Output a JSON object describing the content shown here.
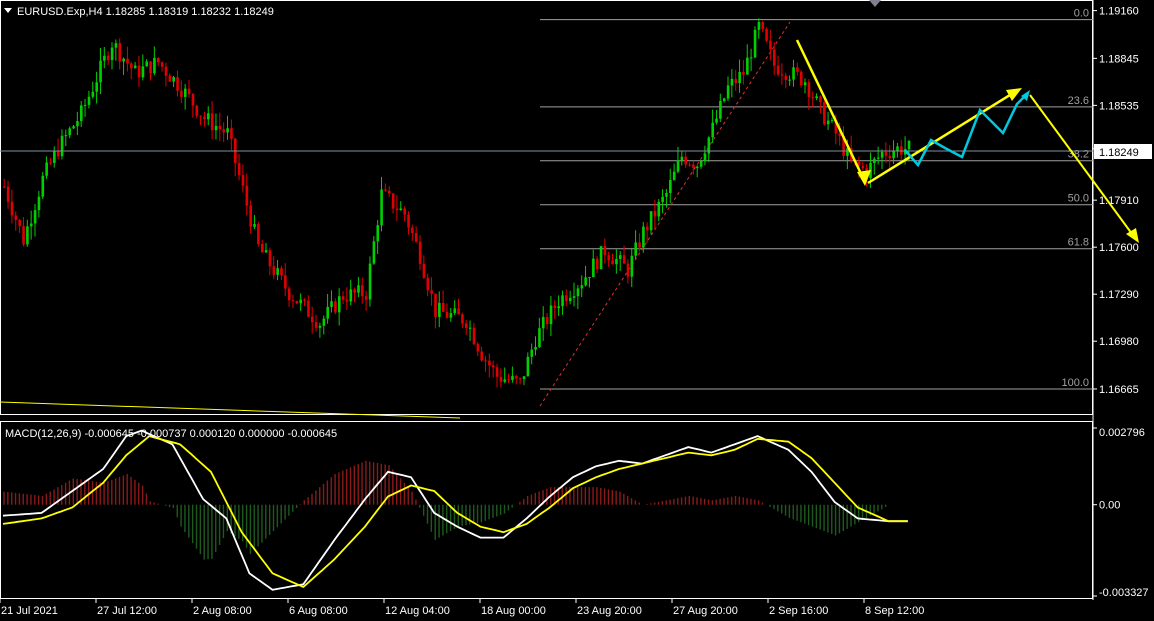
{
  "symbol_header": "EURUSD.Exp,H4  1.18285 1.18319 1.18232 1.18249",
  "macd_header": "MACD(12,26,9) -0.000645 -0.000737 0.000120 0.000000 -0.000645",
  "current_price": "1.18249",
  "colors": {
    "background": "#000000",
    "bull_candle": "#00d000",
    "bear_candle": "#e00000",
    "fib_line": "#a0a0a0",
    "macd_main": "#ffffff",
    "macd_signal": "#ffff00",
    "hist_pos": "#8b1a1a",
    "hist_neg": "#1e5a1e",
    "arrow_yellow": "#ffff00",
    "arrow_cyan": "#00c8e0"
  },
  "chart_data": [
    {
      "type": "candlestick",
      "symbol": "EURUSD.Exp",
      "timeframe": "H4",
      "ylim": [
        1.165,
        1.1921
      ],
      "y_ticks": [
        "1.19160",
        "1.18845",
        "1.18535",
        "1.18249",
        "1.17910",
        "1.17600",
        "1.17290",
        "1.16980",
        "1.16665"
      ],
      "x_ticks": [
        "21 Jul 2021",
        "27 Jul 12:00",
        "2 Aug 08:00",
        "6 Aug 08:00",
        "12 Aug 04:00",
        "18 Aug 00:00",
        "23 Aug 20:00",
        "27 Aug 20:00",
        "2 Sep 16:00",
        "8 Sep 12:00"
      ],
      "anchors": [
        [
          0,
          1.18
        ],
        [
          5,
          1.1765
        ],
        [
          10,
          1.1805
        ],
        [
          14,
          1.1825
        ],
        [
          20,
          1.1848
        ],
        [
          28,
          1.1895
        ],
        [
          34,
          1.1875
        ],
        [
          40,
          1.1882
        ],
        [
          46,
          1.1865
        ],
        [
          52,
          1.1845
        ],
        [
          58,
          1.1835
        ],
        [
          66,
          1.176
        ],
        [
          74,
          1.173
        ],
        [
          82,
          1.171
        ],
        [
          88,
          1.1728
        ],
        [
          94,
          1.173
        ],
        [
          98,
          1.1795
        ],
        [
          104,
          1.1782
        ],
        [
          108,
          1.1755
        ],
        [
          112,
          1.1718
        ],
        [
          120,
          1.1712
        ],
        [
          124,
          1.169
        ],
        [
          128,
          1.1675
        ],
        [
          134,
          1.167
        ],
        [
          138,
          1.17
        ],
        [
          144,
          1.1725
        ],
        [
          150,
          1.1738
        ],
        [
          156,
          1.1758
        ],
        [
          162,
          1.1745
        ],
        [
          166,
          1.177
        ],
        [
          172,
          1.1795
        ],
        [
          176,
          1.182
        ],
        [
          180,
          1.1815
        ],
        [
          184,
          1.1838
        ],
        [
          188,
          1.1865
        ],
        [
          192,
          1.1875
        ],
        [
          196,
          1.1905
        ],
        [
          200,
          1.188
        ],
        [
          204,
          1.1875
        ],
        [
          208,
          1.187
        ],
        [
          212,
          1.185
        ],
        [
          216,
          1.1835
        ],
        [
          220,
          1.1815
        ],
        [
          224,
          1.181
        ],
        [
          228,
          1.1822
        ],
        [
          232,
          1.1825
        ],
        [
          235,
          1.1825
        ]
      ],
      "fibonacci": {
        "levels": [
          {
            "label": "0.0",
            "price": 1.191
          },
          {
            "label": "23.6",
            "price": 1.18525
          },
          {
            "label": "38.2",
            "price": 1.1817
          },
          {
            "label": "50.0",
            "price": 1.1788
          },
          {
            "label": "61.8",
            "price": 1.1759
          },
          {
            "label": "100.0",
            "price": 1.16665
          }
        ]
      }
    },
    {
      "type": "line",
      "name": "MACD(12,26,9)",
      "ylim": [
        -0.003327,
        0.002796
      ],
      "y_ticks": [
        "0.002796",
        "0.00",
        "-0.003327"
      ],
      "series": [
        {
          "name": "main",
          "anchors": [
            [
              0,
              -0.0004
            ],
            [
              10,
              -0.0003
            ],
            [
              18,
              0.0005
            ],
            [
              26,
              0.0013
            ],
            [
              32,
              0.0025
            ],
            [
              36,
              0.0027
            ],
            [
              44,
              0.0022
            ],
            [
              52,
              0.0002
            ],
            [
              58,
              -0.0005
            ],
            [
              64,
              -0.0025
            ],
            [
              70,
              -0.0031
            ],
            [
              78,
              -0.0029
            ],
            [
              86,
              -0.0013
            ],
            [
              94,
              0.0002
            ],
            [
              100,
              0.0012
            ],
            [
              106,
              0.001
            ],
            [
              112,
              -0.0003
            ],
            [
              118,
              -0.0008
            ],
            [
              124,
              -0.0012
            ],
            [
              130,
              -0.0012
            ],
            [
              136,
              -0.0005
            ],
            [
              142,
              0.0003
            ],
            [
              148,
              0.001
            ],
            [
              154,
              0.0014
            ],
            [
              160,
              0.0016
            ],
            [
              166,
              0.0015
            ],
            [
              172,
              0.0018
            ],
            [
              178,
              0.0021
            ],
            [
              184,
              0.0019
            ],
            [
              190,
              0.0022
            ],
            [
              196,
              0.0025
            ],
            [
              204,
              0.002
            ],
            [
              210,
              0.0012
            ],
            [
              216,
              0.0001
            ],
            [
              222,
              -0.0005
            ],
            [
              230,
              -0.0006
            ],
            [
              235,
              -0.0006
            ]
          ]
        },
        {
          "name": "signal",
          "anchors": [
            [
              0,
              -0.0007
            ],
            [
              10,
              -0.0005
            ],
            [
              18,
              -0.0001
            ],
            [
              26,
              0.0008
            ],
            [
              32,
              0.0018
            ],
            [
              38,
              0.0025
            ],
            [
              46,
              0.0022
            ],
            [
              54,
              0.0012
            ],
            [
              62,
              -0.001
            ],
            [
              70,
              -0.0025
            ],
            [
              78,
              -0.003
            ],
            [
              86,
              -0.002
            ],
            [
              94,
              -0.0008
            ],
            [
              100,
              0.0003
            ],
            [
              106,
              0.0007
            ],
            [
              112,
              0.0005
            ],
            [
              118,
              -0.0003
            ],
            [
              124,
              -0.0008
            ],
            [
              130,
              -0.001
            ],
            [
              136,
              -0.0007
            ],
            [
              142,
              -0.0001
            ],
            [
              148,
              0.0006
            ],
            [
              154,
              0.001
            ],
            [
              160,
              0.0013
            ],
            [
              166,
              0.0015
            ],
            [
              172,
              0.0017
            ],
            [
              178,
              0.0019
            ],
            [
              184,
              0.0018
            ],
            [
              190,
              0.002
            ],
            [
              196,
              0.0024
            ],
            [
              204,
              0.0023
            ],
            [
              210,
              0.0017
            ],
            [
              216,
              0.0008
            ],
            [
              222,
              -0.0001
            ],
            [
              230,
              -0.0006
            ],
            [
              235,
              -0.0006
            ]
          ]
        }
      ]
    }
  ]
}
